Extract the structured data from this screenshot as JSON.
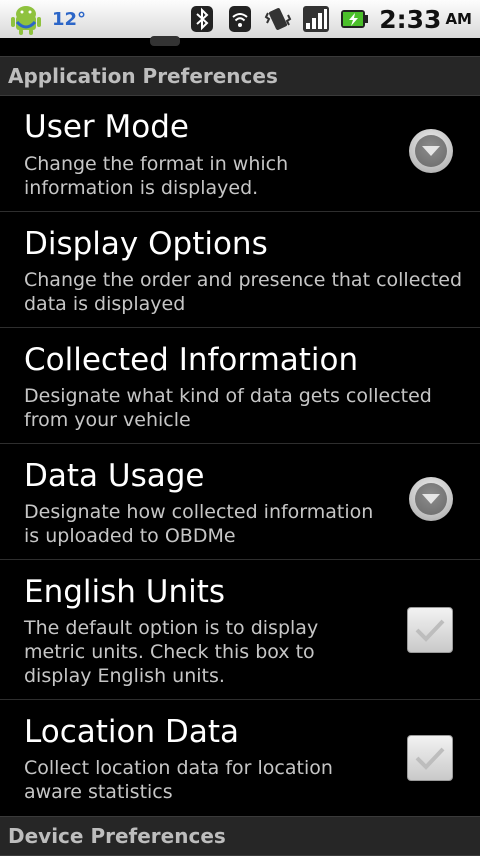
{
  "status_bar": {
    "temperature": "12°",
    "time": "2:33",
    "ampm": "AM",
    "icons": [
      "android-weather-icon",
      "bluetooth-icon",
      "wifi-icon",
      "vibrate-icon",
      "signal-icon",
      "battery-charging-icon"
    ]
  },
  "categories": {
    "application": "Application Preferences",
    "device": "Device Preferences"
  },
  "preferences": [
    {
      "title": "User Mode",
      "summary": "Change the format in which information is displayed.",
      "widget": "dropdown"
    },
    {
      "title": "Display Options",
      "summary": "Change the order and presence that collected data is displayed",
      "widget": "none"
    },
    {
      "title": "Collected Information",
      "summary": "Designate what kind of data gets collected from your vehicle",
      "widget": "none"
    },
    {
      "title": "Data Usage",
      "summary": "Designate how collected information is uploaded to OBDMe",
      "widget": "dropdown"
    },
    {
      "title": "English Units",
      "summary": "The default option is to display metric units. Check this box to display English units.",
      "widget": "checkbox",
      "checked": true
    },
    {
      "title": "Location Data",
      "summary": "Collect location data for location aware statistics",
      "widget": "checkbox",
      "checked": true
    }
  ]
}
